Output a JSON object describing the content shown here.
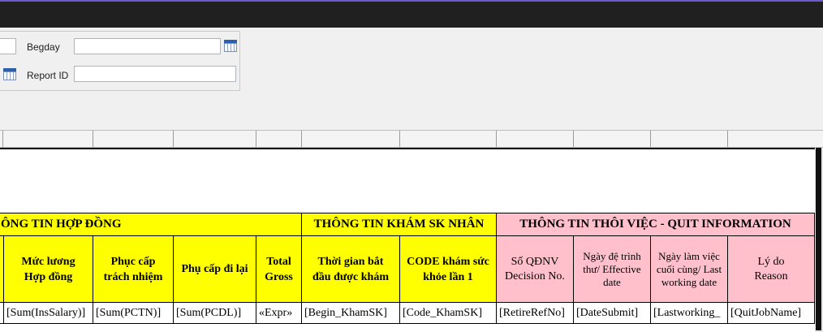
{
  "params": {
    "begday_label": "Begday",
    "begday_value": "",
    "reportid_label": "Report ID",
    "reportid_value": ""
  },
  "icons": {
    "calendar": "calendar-icon"
  },
  "table": {
    "group_headers": [
      "ÔNG TIN HỢP ĐỒNG",
      "THÔNG TIN KHÁM SK NHÂN",
      "THÔNG TIN THÔI VIỆC - QUIT INFORMATION"
    ],
    "columns": [
      {
        "header": "",
        "field": ""
      },
      {
        "header": "Mức lương Hợp đồng",
        "field": "[Sum(InsSalary)]"
      },
      {
        "header": "Phục cấp trách nhiệm",
        "field": "[Sum(PCTN)]"
      },
      {
        "header": "Phụ cấp đi lại",
        "field": "[Sum(PCDL)]"
      },
      {
        "header": "Total Gross",
        "field": "«Expr»"
      },
      {
        "header": "Thời gian bắt đầu được khám",
        "field": "[Begin_KhamSK]"
      },
      {
        "header": "CODE khám sức khỏe lần 1",
        "field": "[Code_KhamSK]"
      },
      {
        "header": "Số QĐNV Decision No.",
        "field": "[RetireRefNo]"
      },
      {
        "header": "Ngày đệ trình thư/ Effective date",
        "field": "[DateSubmit]"
      },
      {
        "header": "Ngày làm việc cuối cùng/ Last working date",
        "field": "[Lastworking_"
      },
      {
        "header": "Lý do Reason",
        "field": "[QuitJobName]"
      }
    ]
  },
  "colors": {
    "group_yellow": "#ffff00",
    "group_pink": "#ffc0cb",
    "titlebar": "#202020"
  }
}
